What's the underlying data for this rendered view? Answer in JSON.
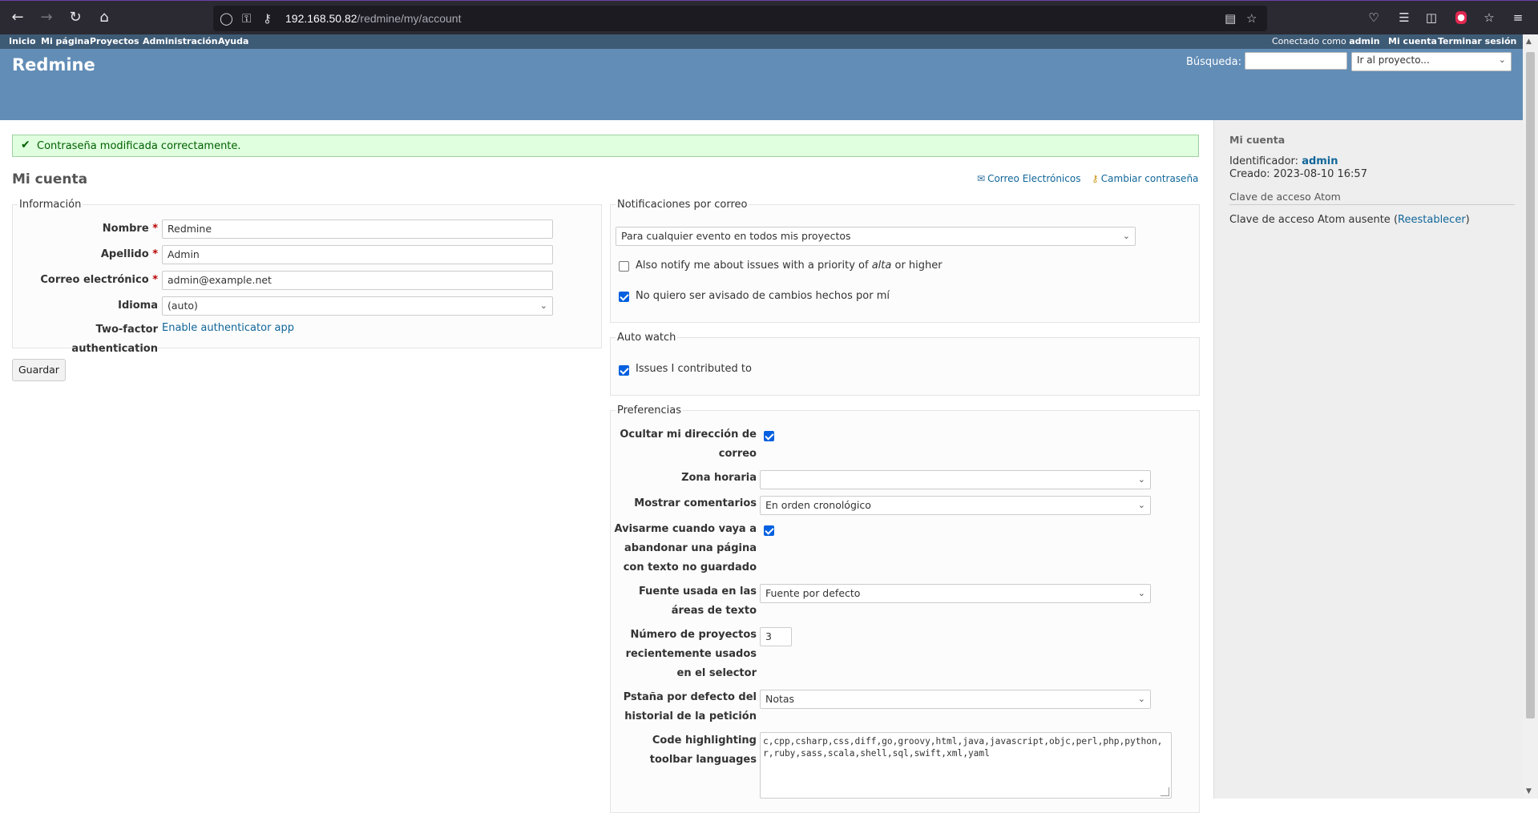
{
  "browser": {
    "url_host": "192.168.50.82",
    "url_path": "/redmine/my/account"
  },
  "top_menu": {
    "items": [
      "Inicio",
      "Mi página",
      "Proyectos",
      "Administración",
      "Ayuda"
    ],
    "logged_as_prefix": "Conectado como",
    "logged_as_user": "admin",
    "my_account": "Mi cuenta",
    "logout": "Terminar sesión"
  },
  "header": {
    "title": "Redmine",
    "search_label": "Búsqueda:",
    "search_value": "",
    "jump_placeholder": "Ir al proyecto..."
  },
  "flash": {
    "message": "Contraseña modificada correctamente."
  },
  "page": {
    "title": "Mi cuenta",
    "email_link": "Correo Electrónicos",
    "password_link": "Cambiar contraseña"
  },
  "info": {
    "legend": "Información",
    "nombre_label": "Nombre",
    "nombre_value": "Redmine",
    "apellido_label": "Apellido",
    "apellido_value": "Admin",
    "correo_label": "Correo electrónico",
    "correo_value": "admin@example.net",
    "idioma_label": "Idioma",
    "idioma_value": "(auto)",
    "twofa_label": "Two-factor authentication",
    "twofa_link": "Enable authenticator app",
    "required_mark": "*"
  },
  "save_button": "Guardar",
  "notifications": {
    "legend": "Notificaciones por correo",
    "select_value": "Para cualquier evento en todos mis proyectos",
    "priority_text_before": "Also notify me about issues with a priority of ",
    "priority_value": "alta",
    "priority_text_after": " or higher",
    "priority_checked": false,
    "no_self_text": "No quiero ser avisado de cambios hechos por mí",
    "no_self_checked": true
  },
  "auto_watch": {
    "legend": "Auto watch",
    "issues_text": "Issues I contributed to",
    "issues_checked": true
  },
  "preferences": {
    "legend": "Preferencias",
    "hide_mail_label": "Ocultar mi dirección de correo",
    "hide_mail_checked": true,
    "timezone_label": "Zona horaria",
    "timezone_value": "",
    "comments_label": "Mostrar comentarios",
    "comments_value": "En orden cronológico",
    "warn_label": "Avisarme cuando vaya a abandonar una página con texto no guardado",
    "warn_checked": true,
    "font_label": "Fuente usada en las áreas de texto",
    "font_value": "Fuente por defecto",
    "recent_label": "Número de proyectos recientemente usados en el selector",
    "recent_value": "3",
    "tab_label": "Pstaña por defecto del historial de la petición",
    "tab_value": "Notas",
    "toolbar_label": "Code highlighting toolbar languages",
    "toolbar_value": "c,cpp,csharp,css,diff,go,groovy,html,java,javascript,objc,perl,php,python,r,ruby,sass,scala,shell,sql,swift,xml,yaml"
  },
  "sidebar": {
    "heading": "Mi cuenta",
    "login_label": "Identificador:",
    "login_value": "admin",
    "created_label": "Creado:",
    "created_value": "2023-08-10 16:57",
    "atom_heading": "Clave de acceso Atom",
    "atom_text": "Clave de acceso Atom ausente",
    "atom_reset": "Reestablecer"
  }
}
